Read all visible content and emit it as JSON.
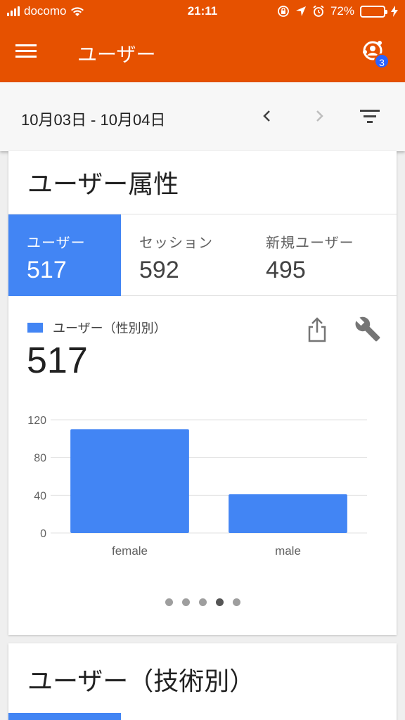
{
  "status_bar": {
    "carrier": "docomo",
    "time": "21:11",
    "battery_percent": "72%",
    "battery_level": 0.72
  },
  "app_bar": {
    "title": "ユーザー",
    "notification_count": "3",
    "color": "#e65100"
  },
  "date_bar": {
    "range": "10月03日 - 10月04日"
  },
  "card1": {
    "title": "ユーザー属性",
    "tabs": [
      {
        "label": "ユーザー",
        "value": "517",
        "active": true
      },
      {
        "label": "セッション",
        "value": "592",
        "active": false
      },
      {
        "label": "新規ユーザー",
        "value": "495",
        "active": false
      }
    ],
    "legend_label": "ユーザー（性別別）",
    "total": "517",
    "accent_color": "#4285f4",
    "page_count": 5,
    "active_page": 4
  },
  "chart_data": {
    "type": "bar",
    "categories": [
      "female",
      "male"
    ],
    "values": [
      110,
      41
    ],
    "yticks": [
      0,
      40,
      80,
      120
    ],
    "ylim": [
      0,
      120
    ],
    "grid": true,
    "color": "#4285f4"
  },
  "card2": {
    "title": "ユーザー（技術別）"
  }
}
